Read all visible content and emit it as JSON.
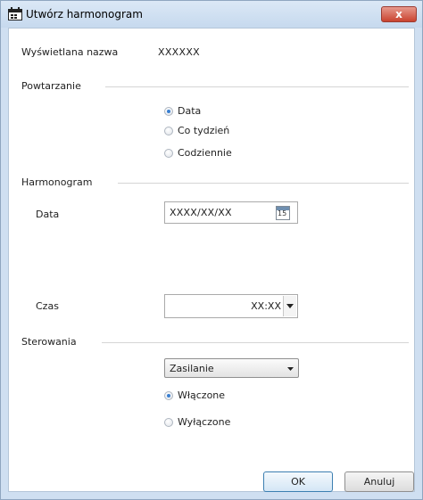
{
  "window": {
    "title": "Utwórz harmonogram",
    "close_glyph": "x"
  },
  "display_name": {
    "label": "Wyświetlana nazwa",
    "value": "XXXXXX"
  },
  "repetition": {
    "group_label": "Powtarzanie",
    "options": [
      {
        "label": "Data",
        "selected": true
      },
      {
        "label": "Co tydzień",
        "selected": false
      },
      {
        "label": "Codziennie",
        "selected": false
      }
    ]
  },
  "schedule": {
    "group_label": "Harmonogram",
    "date_label": "Data",
    "date_value": "XXXX/XX/XX",
    "calendar_icon_text": "15",
    "time_label": "Czas",
    "time_value": "XX:XX"
  },
  "control": {
    "group_label": "Sterowania",
    "select_value": "Zasilanie",
    "options": [
      {
        "label": "Włączone",
        "selected": true
      },
      {
        "label": "Wyłączone",
        "selected": false
      }
    ]
  },
  "buttons": {
    "ok": "OK",
    "cancel": "Anuluj"
  },
  "colors": {
    "accent": "#3a7fd0",
    "close": "#c9432f",
    "frame": "#cfdff1"
  }
}
